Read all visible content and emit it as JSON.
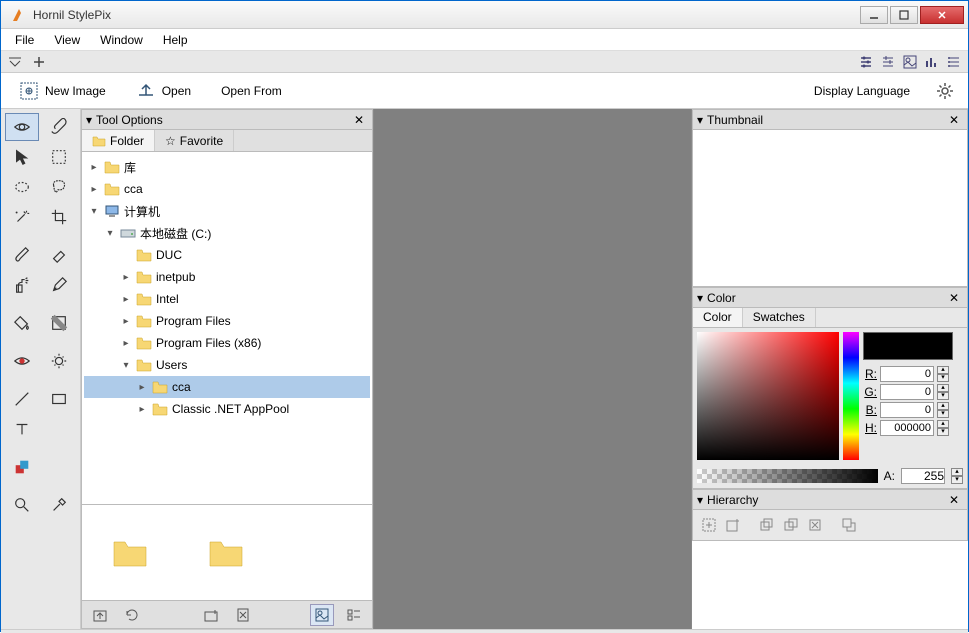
{
  "app": {
    "title": "Hornil StylePix"
  },
  "menus": [
    "File",
    "View",
    "Window",
    "Help"
  ],
  "toolbar": {
    "new_image": "New Image",
    "open": "Open",
    "open_from": "Open From",
    "display_language": "Display Language"
  },
  "panels": {
    "tool_options": {
      "title": "Tool Options",
      "tabs": {
        "folder": "Folder",
        "favorite": "Favorite"
      }
    },
    "thumbnail": {
      "title": "Thumbnail"
    },
    "color": {
      "title": "Color",
      "tabs": {
        "color": "Color",
        "swatches": "Swatches"
      },
      "fields": {
        "r_label": "R:",
        "g_label": "G:",
        "b_label": "B:",
        "h_label": "H:",
        "a_label": "A:"
      },
      "values": {
        "r": "0",
        "g": "0",
        "b": "0",
        "h": "000000",
        "a": "255"
      }
    },
    "hierarchy": {
      "title": "Hierarchy"
    }
  },
  "tree": [
    {
      "label": "库",
      "depth": 0,
      "icon": "folder",
      "expand": "collapsed"
    },
    {
      "label": "cca",
      "depth": 0,
      "icon": "folder",
      "expand": "collapsed"
    },
    {
      "label": "计算机",
      "depth": 0,
      "icon": "computer",
      "expand": "expanded"
    },
    {
      "label": "本地磁盘 (C:)",
      "depth": 1,
      "icon": "drive",
      "expand": "expanded"
    },
    {
      "label": "DUC",
      "depth": 2,
      "icon": "folder",
      "expand": "none"
    },
    {
      "label": "inetpub",
      "depth": 2,
      "icon": "folder",
      "expand": "collapsed"
    },
    {
      "label": "Intel",
      "depth": 2,
      "icon": "folder",
      "expand": "collapsed"
    },
    {
      "label": "Program Files",
      "depth": 2,
      "icon": "folder",
      "expand": "collapsed"
    },
    {
      "label": "Program Files (x86)",
      "depth": 2,
      "icon": "folder",
      "expand": "collapsed"
    },
    {
      "label": "Users",
      "depth": 2,
      "icon": "folder",
      "expand": "expanded"
    },
    {
      "label": "cca",
      "depth": 3,
      "icon": "folder",
      "expand": "collapsed",
      "selected": true
    },
    {
      "label": "Classic .NET AppPool",
      "depth": 3,
      "icon": "folder",
      "expand": "collapsed"
    }
  ]
}
